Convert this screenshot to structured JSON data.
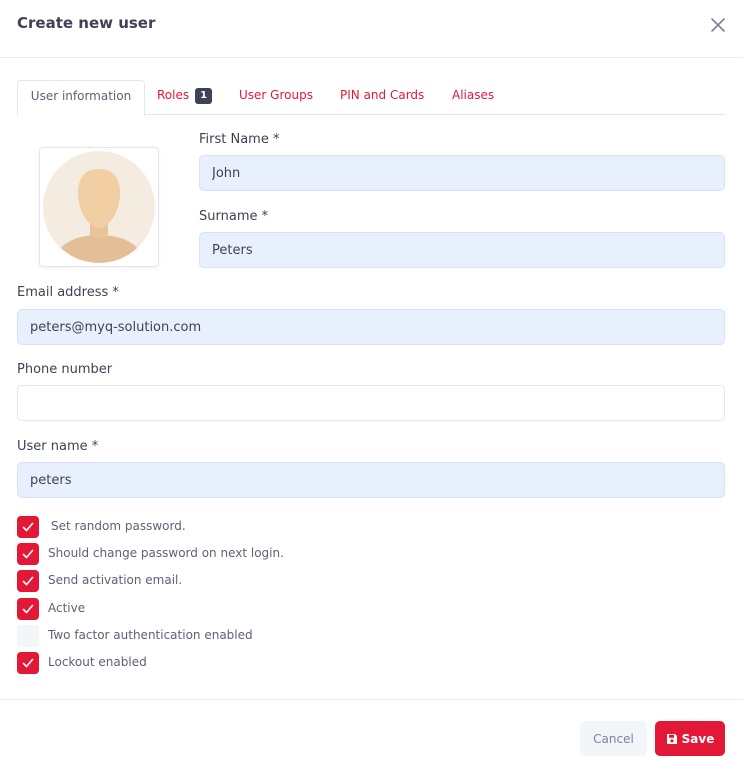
{
  "dialog": {
    "title": "Create new user"
  },
  "tabs": [
    {
      "label": "User information",
      "active": true
    },
    {
      "label": "Roles",
      "badge": "1"
    },
    {
      "label": "User Groups"
    },
    {
      "label": "PIN and Cards"
    },
    {
      "label": "Aliases"
    }
  ],
  "form": {
    "first_name": {
      "label": "First Name *",
      "value": "John"
    },
    "surname": {
      "label": "Surname *",
      "value": "Peters"
    },
    "email": {
      "label": "Email address *",
      "value": "peters@myq-solution.com"
    },
    "phone": {
      "label": "Phone number",
      "value": ""
    },
    "username": {
      "label": "User name *",
      "value": "peters"
    }
  },
  "options": [
    {
      "label": "Set random password.",
      "checked": true
    },
    {
      "label": "Should change password on next login.",
      "checked": true
    },
    {
      "label": "Send activation email.",
      "checked": true
    },
    {
      "label": "Active",
      "checked": true
    },
    {
      "label": "Two factor authentication enabled",
      "checked": false
    },
    {
      "label": "Lockout enabled",
      "checked": true
    }
  ],
  "footer": {
    "cancel_label": "Cancel",
    "save_label": "Save"
  },
  "colors": {
    "accent": "#e31837",
    "input_filled_bg": "#e8f0fe",
    "text": "#3f4254"
  },
  "icons": {
    "close": "close-icon",
    "checkmark": "checkmark-icon",
    "save": "floppy-disk-icon",
    "avatar": "user-avatar-placeholder"
  }
}
